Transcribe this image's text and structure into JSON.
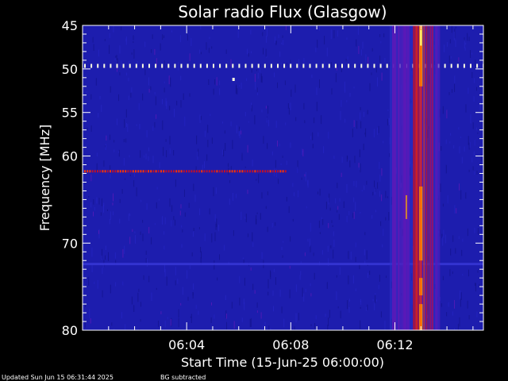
{
  "chart_data": {
    "type": "heatmap",
    "title": "Solar radio Flux (Glasgow)",
    "xlabel": "Start Time (15-Jun-25 06:00:00)",
    "ylabel": "Frequency [MHz]",
    "x_unit": "minutes after 06:00:00",
    "xlim": [
      0,
      15.4
    ],
    "ylim": [
      80,
      45
    ],
    "x_ticks": [
      {
        "value": 4,
        "label": "06:04"
      },
      {
        "value": 8,
        "label": "06:08"
      },
      {
        "value": 12,
        "label": "06:12"
      }
    ],
    "y_ticks": [
      {
        "value": 45,
        "label": "45"
      },
      {
        "value": 50,
        "label": "50"
      },
      {
        "value": 55,
        "label": "55"
      },
      {
        "value": 60,
        "label": "60"
      },
      {
        "value": 70,
        "label": "70"
      },
      {
        "value": 80,
        "label": "80"
      }
    ],
    "colormap": [
      "#1a1aa8",
      "#5a1ab8",
      "#c0102a",
      "#ff3300",
      "#ffb000",
      "#ffff80"
    ],
    "background_color": "#1d1dae",
    "features": [
      {
        "kind": "horizontal-line",
        "freq_mhz": 49.6,
        "x_from": 0,
        "x_to": 15.4,
        "style": "dotted",
        "intensity": "high"
      },
      {
        "kind": "horizontal-line",
        "freq_mhz": 61.8,
        "x_from": 0,
        "x_to": 7.8,
        "style": "dotted",
        "intensity": "medium"
      },
      {
        "kind": "horizontal-line",
        "freq_mhz": 72.4,
        "x_from": 0,
        "x_to": 15.4,
        "style": "solid",
        "intensity": "low"
      },
      {
        "kind": "point",
        "x": 5.8,
        "freq_mhz": 51.2,
        "intensity": "high"
      },
      {
        "kind": "burst-band",
        "x_from": 11.8,
        "x_to": 13.7,
        "freq_from": 45,
        "freq_to": 80,
        "peak_x": 13.0,
        "intensity": "high"
      }
    ]
  },
  "footer": {
    "updated_text": "Updated Sun Jun 15 06:31:44 2025",
    "bg_text": "BG subtracted"
  }
}
